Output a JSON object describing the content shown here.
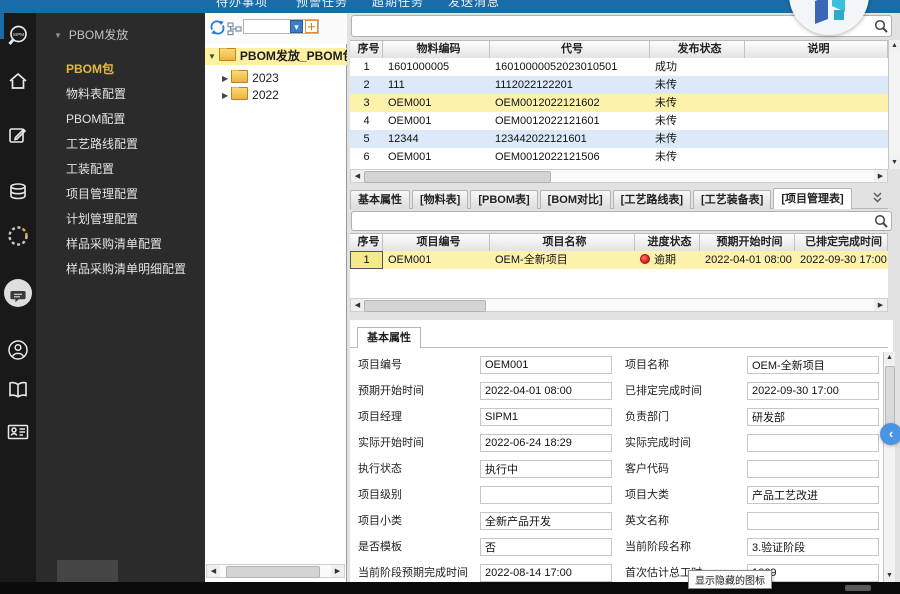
{
  "glyphs": {
    "caret_down": "▼",
    "caret_right": "▶",
    "scroll_up": "▲",
    "scroll_down": "▼",
    "scroll_left": "◀",
    "scroll_right": "▶",
    "chevron_left": "‹",
    "plus_icon": "＋",
    "dropdown_arrow": "▾"
  },
  "colors": {
    "topbar_blue": "#1a6ca8",
    "sidebar_dark": "#2b2b2b",
    "rail_dark": "#191919",
    "active_gold": "#e8b93e",
    "row_alt_blue": "#dce9f8",
    "row_selected_yellow": "#fdf2ac",
    "status_red": "#d81818",
    "collapse_blue": "#4a94e4"
  },
  "topbar": {
    "menu_items": [
      "待办事项",
      "预警任务",
      "超期任务",
      "发送消息"
    ]
  },
  "icon_rail": {
    "logo_text": "SIPM",
    "icons": [
      "sipm-search-icon",
      "home-icon",
      "edit-icon",
      "database-icon",
      "spinner-icon",
      "chat-icon",
      "support-headset-icon",
      "book-icon",
      "contact-card-icon"
    ]
  },
  "sidebar": {
    "group_label": "PBOM发放",
    "items": [
      {
        "label": "PBOM包",
        "active": true
      },
      {
        "label": "物料表配置",
        "active": false
      },
      {
        "label": "PBOM配置",
        "active": false
      },
      {
        "label": "工艺路线配置",
        "active": false
      },
      {
        "label": "工装配置",
        "active": false
      },
      {
        "label": "项目管理配置",
        "active": false
      },
      {
        "label": "计划管理配置",
        "active": false
      },
      {
        "label": "样品采购清单配置",
        "active": false
      },
      {
        "label": "样品采购清单明细配置",
        "active": false
      }
    ]
  },
  "tree": {
    "root": {
      "label": "PBOM发放_PBOM包",
      "selected": true
    },
    "children": [
      {
        "label": "2023"
      },
      {
        "label": "2022"
      }
    ],
    "filter_value": ""
  },
  "top_search": {
    "value": ""
  },
  "material_table": {
    "headers": [
      "序号",
      "物料编码",
      "代号",
      "发布状态",
      "说明"
    ],
    "rows": [
      {
        "seq": "1",
        "code": "1601000005",
        "alias": "16010000052023010501",
        "status": "成功",
        "note": ""
      },
      {
        "seq": "2",
        "code": "111",
        "alias": "1112022122201",
        "status": "未传",
        "note": "",
        "alt": true
      },
      {
        "seq": "3",
        "code": "OEM001",
        "alias": "OEM0012022121602",
        "status": "未传",
        "note": "",
        "selected": true
      },
      {
        "seq": "4",
        "code": "OEM001",
        "alias": "OEM0012022121601",
        "status": "未传",
        "note": ""
      },
      {
        "seq": "5",
        "code": "12344",
        "alias": "123442022121601",
        "status": "未传",
        "note": "",
        "alt": true
      },
      {
        "seq": "6",
        "code": "OEM001",
        "alias": "OEM0012022121506",
        "status": "未传",
        "note": ""
      }
    ]
  },
  "detail_tabs": {
    "tabs": [
      "基本属性",
      "[物料表]",
      "[PBOM表]",
      "[BOM对比]",
      "[工艺路线表]",
      "[工艺装备表]",
      "[项目管理表]"
    ],
    "active_index": 6
  },
  "project_search": {
    "value": ""
  },
  "project_table": {
    "headers": [
      "序号",
      "项目编号",
      "项目名称",
      "进度状态",
      "预期开始时间",
      "已排定完成时间"
    ],
    "rows": [
      {
        "seq": "1",
        "number": "OEM001",
        "name": "OEM-全新项目",
        "status": "逾期",
        "start": "2022-04-01 08:00",
        "end": "2022-09-30 17:00",
        "selected": true
      }
    ]
  },
  "detail_form": {
    "tab_label": "基本属性",
    "rows": [
      [
        {
          "label": "项目编号",
          "value": "OEM001"
        },
        {
          "label": "项目名称",
          "value": "OEM-全新项目"
        }
      ],
      [
        {
          "label": "预期开始时间",
          "value": "2022-04-01 08:00"
        },
        {
          "label": "已排定完成时间",
          "value": "2022-09-30 17:00"
        }
      ],
      [
        {
          "label": "项目经理",
          "value": "SIPM1"
        },
        {
          "label": "负责部门",
          "value": "研发部"
        }
      ],
      [
        {
          "label": "实际开始时间",
          "value": "2022-06-24 18:29"
        },
        {
          "label": "实际完成时间",
          "value": ""
        }
      ],
      [
        {
          "label": "执行状态",
          "value": "执行中"
        },
        {
          "label": "客户代码",
          "value": ""
        }
      ],
      [
        {
          "label": "项目级别",
          "value": ""
        },
        {
          "label": "项目大类",
          "value": "产品工艺改进"
        }
      ],
      [
        {
          "label": "项目小类",
          "value": "全新产品开发"
        },
        {
          "label": "英文名称",
          "value": ""
        }
      ],
      [
        {
          "label": "是否模板",
          "value": "否"
        },
        {
          "label": "当前阶段名称",
          "value": "3.验证阶段"
        }
      ],
      [
        {
          "label": "当前阶段预期完成时间",
          "value": "2022-08-14 17:00"
        },
        {
          "label": "首次估计总工时",
          "value": "1069"
        }
      ]
    ]
  },
  "tooltip": {
    "text": "显示隐藏的图标"
  }
}
